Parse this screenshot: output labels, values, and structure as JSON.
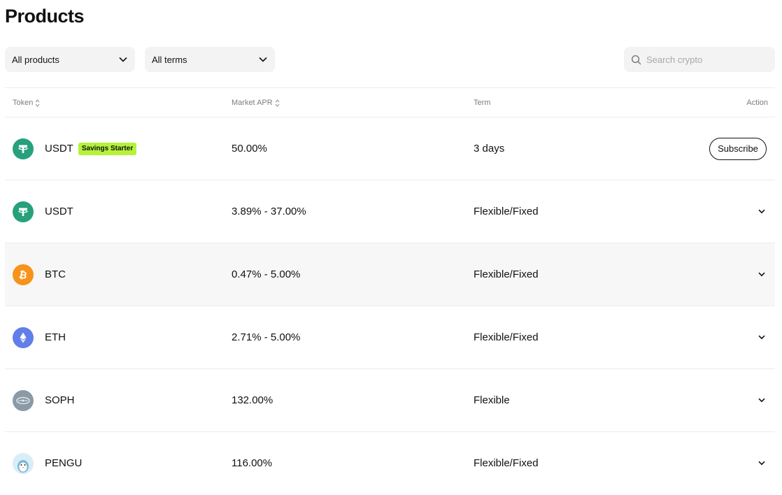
{
  "page": {
    "title": "Products"
  },
  "filters": {
    "product_select": "All products",
    "term_select": "All terms",
    "search_placeholder": "Search crypto"
  },
  "table": {
    "headers": {
      "token": "Token",
      "apr": "Market APR",
      "term": "Term",
      "action": "Action"
    },
    "rows": [
      {
        "token": "USDT",
        "badge": "Savings Starter",
        "apr": "50.00%",
        "term": "3 days",
        "action_label": "Subscribe",
        "icon": "tether-icon",
        "color": "#26a17b"
      },
      {
        "token": "USDT",
        "apr": "3.89% - 37.00%",
        "term": "Flexible/Fixed",
        "icon": "tether-icon",
        "color": "#26a17b"
      },
      {
        "token": "BTC",
        "apr": "0.47% - 5.00%",
        "term": "Flexible/Fixed",
        "icon": "bitcoin-icon",
        "color": "#f7931a"
      },
      {
        "token": "ETH",
        "apr": "2.71% - 5.00%",
        "term": "Flexible/Fixed",
        "icon": "ethereum-icon",
        "color": "#627eea"
      },
      {
        "token": "SOPH",
        "apr": "132.00%",
        "term": "Flexible",
        "icon": "sophon-icon",
        "color": "#8a9aa6"
      },
      {
        "token": "PENGU",
        "apr": "116.00%",
        "term": "Flexible/Fixed",
        "icon": "pengu-icon",
        "color": "#d8eef7"
      }
    ]
  },
  "colors": {
    "badge": "#b5f23a",
    "row_highlight": "#f7f7f7",
    "divider": "#ececec"
  }
}
